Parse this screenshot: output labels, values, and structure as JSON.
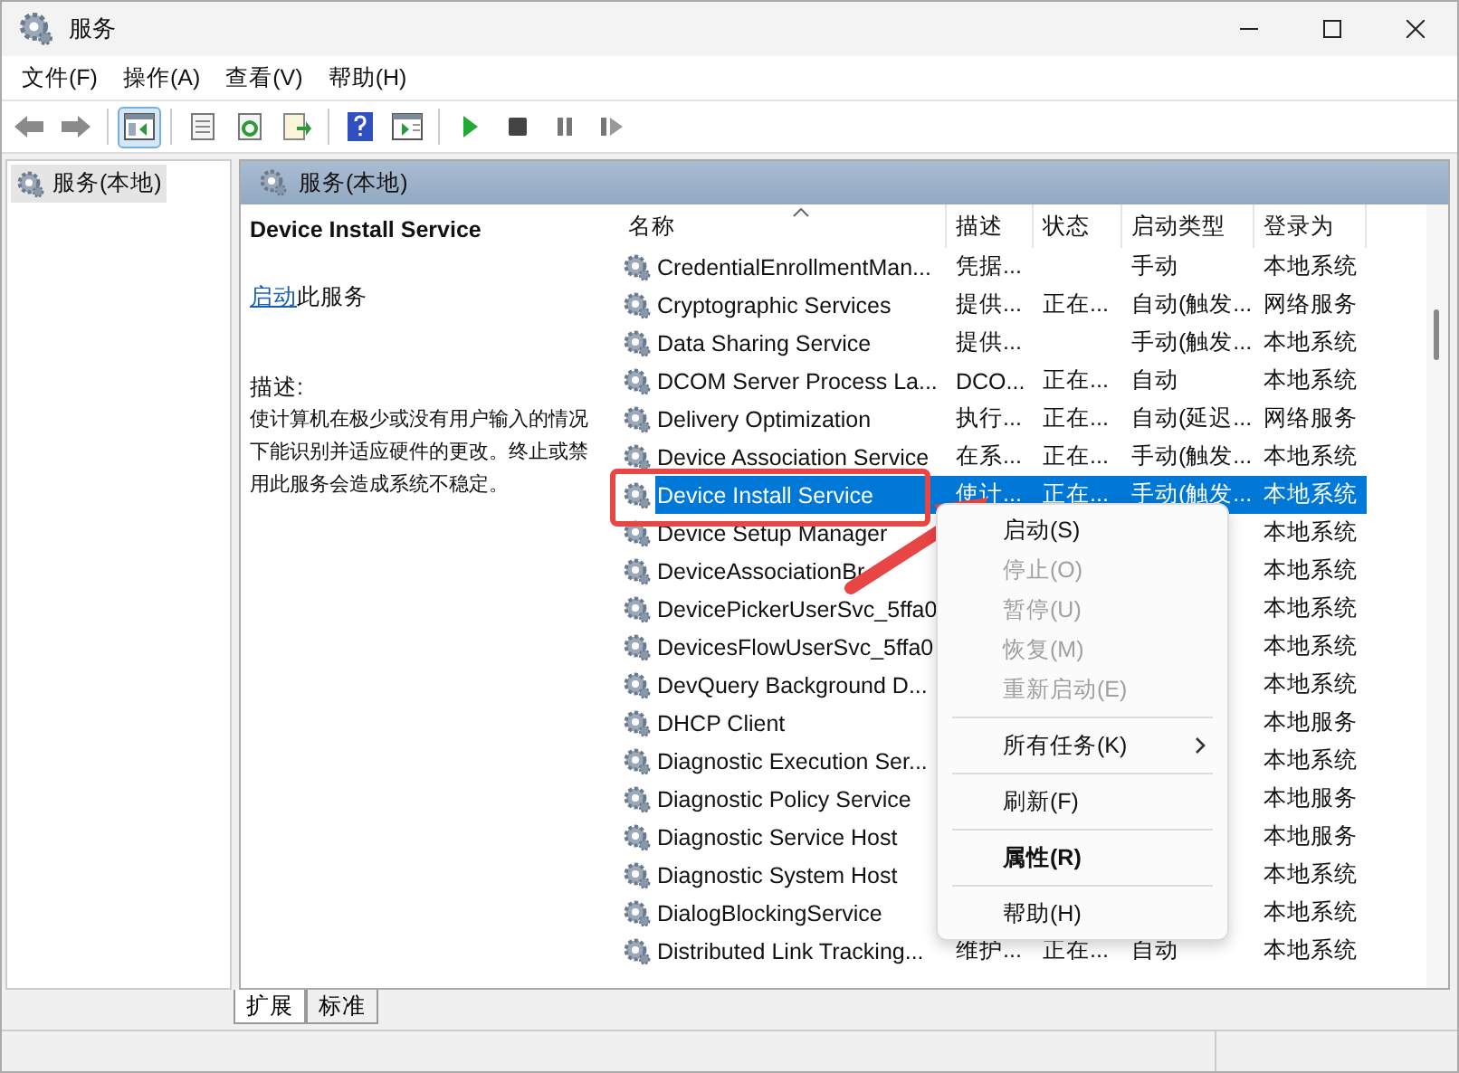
{
  "window": {
    "title": "服务"
  },
  "menu": [
    "文件(F)",
    "操作(A)",
    "查看(V)",
    "帮助(H)"
  ],
  "toolbar": [
    {
      "kind": "back",
      "selected": false
    },
    {
      "kind": "forward",
      "selected": false
    },
    {
      "kind": "sep"
    },
    {
      "kind": "tree",
      "selected": true
    },
    {
      "kind": "sep"
    },
    {
      "kind": "properties",
      "selected": false
    },
    {
      "kind": "refresh",
      "selected": false
    },
    {
      "kind": "export",
      "selected": false
    },
    {
      "kind": "sep"
    },
    {
      "kind": "help",
      "selected": false
    },
    {
      "kind": "console",
      "selected": false
    },
    {
      "kind": "sep"
    },
    {
      "kind": "play",
      "selected": false
    },
    {
      "kind": "stop",
      "selected": false
    },
    {
      "kind": "pause",
      "selected": false
    },
    {
      "kind": "restart",
      "selected": false
    }
  ],
  "tree": {
    "items": [
      {
        "label": "服务(本地)",
        "selected": true
      }
    ]
  },
  "panel": {
    "title": "服务(本地)"
  },
  "details": {
    "service": "Device Install Service",
    "action_link": "启动",
    "action_text": "此服务",
    "desc_label": "描述:",
    "description": "使计算机在极少或没有用户输入的情况下能识别并适应硬件的更改。终止或禁用此服务会造成系统不稳定。"
  },
  "table": {
    "columns": [
      "名称",
      "描述",
      "状态",
      "启动类型",
      "登录为"
    ],
    "rows": [
      {
        "name": "CredentialEnrollmentMan...",
        "desc": "凭据...",
        "status": "",
        "startup": "手动",
        "logon": "本地系统",
        "selected": false
      },
      {
        "name": "Cryptographic Services",
        "desc": "提供...",
        "status": "正在...",
        "startup": "自动(触发...",
        "logon": "网络服务",
        "selected": false
      },
      {
        "name": "Data Sharing Service",
        "desc": "提供...",
        "status": "",
        "startup": "手动(触发...",
        "logon": "本地系统",
        "selected": false
      },
      {
        "name": "DCOM Server Process La...",
        "desc": "DCO...",
        "status": "正在...",
        "startup": "自动",
        "logon": "本地系统",
        "selected": false
      },
      {
        "name": "Delivery Optimization",
        "desc": "执行...",
        "status": "正在...",
        "startup": "自动(延迟...",
        "logon": "网络服务",
        "selected": false
      },
      {
        "name": "Device Association Service",
        "desc": "在系...",
        "status": "正在...",
        "startup": "手动(触发...",
        "logon": "本地系统",
        "selected": false
      },
      {
        "name": "Device Install Service",
        "desc": "使计...",
        "status": "正在...",
        "startup": "手动(触发...",
        "logon": "本地系统",
        "selected": true
      },
      {
        "name": "Device Setup Manager",
        "desc": "",
        "status": "",
        "startup": "",
        "logon": "本地系统",
        "selected": false
      },
      {
        "name": "DeviceAssociationBr",
        "desc": "",
        "status": "",
        "startup": "",
        "logon": "本地系统",
        "selected": false
      },
      {
        "name": "DevicePickerUserSvc_5ffa0",
        "desc": "",
        "status": "",
        "startup": "",
        "logon": "本地系统",
        "selected": false
      },
      {
        "name": "DevicesFlowUserSvc_5ffa0",
        "desc": "",
        "status": "",
        "startup": "",
        "logon": "本地系统",
        "selected": false
      },
      {
        "name": "DevQuery Background D...",
        "desc": "",
        "status": "",
        "startup": "",
        "logon": "本地系统",
        "selected": false
      },
      {
        "name": "DHCP Client",
        "desc": "",
        "status": "",
        "startup": "",
        "logon": "本地服务",
        "selected": false
      },
      {
        "name": "Diagnostic Execution Ser...",
        "desc": "",
        "status": "",
        "startup": "",
        "logon": "本地系统",
        "selected": false
      },
      {
        "name": "Diagnostic Policy Service",
        "desc": "",
        "status": "",
        "startup": "",
        "logon": "本地服务",
        "selected": false
      },
      {
        "name": "Diagnostic Service Host",
        "desc": "",
        "status": "",
        "startup": "",
        "logon": "本地服务",
        "selected": false
      },
      {
        "name": "Diagnostic System Host",
        "desc": "",
        "status": "",
        "startup": "",
        "logon": "本地系统",
        "selected": false
      },
      {
        "name": "DialogBlockingService",
        "desc": "",
        "status": "",
        "startup": "",
        "logon": "本地系统",
        "selected": false
      },
      {
        "name": "Distributed Link Tracking...",
        "desc": "维护...",
        "status": "正在...",
        "startup": "自动",
        "logon": "本地系统",
        "selected": false
      }
    ]
  },
  "context_menu": [
    {
      "kind": "item",
      "label": "启动(S)",
      "disabled": false,
      "bold": false,
      "submenu": false
    },
    {
      "kind": "item",
      "label": "停止(O)",
      "disabled": true,
      "bold": false,
      "submenu": false
    },
    {
      "kind": "item",
      "label": "暂停(U)",
      "disabled": true,
      "bold": false,
      "submenu": false
    },
    {
      "kind": "item",
      "label": "恢复(M)",
      "disabled": true,
      "bold": false,
      "submenu": false
    },
    {
      "kind": "item",
      "label": "重新启动(E)",
      "disabled": true,
      "bold": false,
      "submenu": false
    },
    {
      "kind": "separator"
    },
    {
      "kind": "item",
      "label": "所有任务(K)",
      "disabled": false,
      "bold": false,
      "submenu": true
    },
    {
      "kind": "separator"
    },
    {
      "kind": "item",
      "label": "刷新(F)",
      "disabled": false,
      "bold": false,
      "submenu": false
    },
    {
      "kind": "separator"
    },
    {
      "kind": "item",
      "label": "属性(R)",
      "disabled": false,
      "bold": true,
      "submenu": false
    },
    {
      "kind": "separator"
    },
    {
      "kind": "item",
      "label": "帮助(H)",
      "disabled": false,
      "bold": false,
      "submenu": false
    }
  ],
  "bottom_tabs": [
    {
      "label": "扩展",
      "selected": true
    },
    {
      "label": "标准",
      "selected": false
    }
  ]
}
